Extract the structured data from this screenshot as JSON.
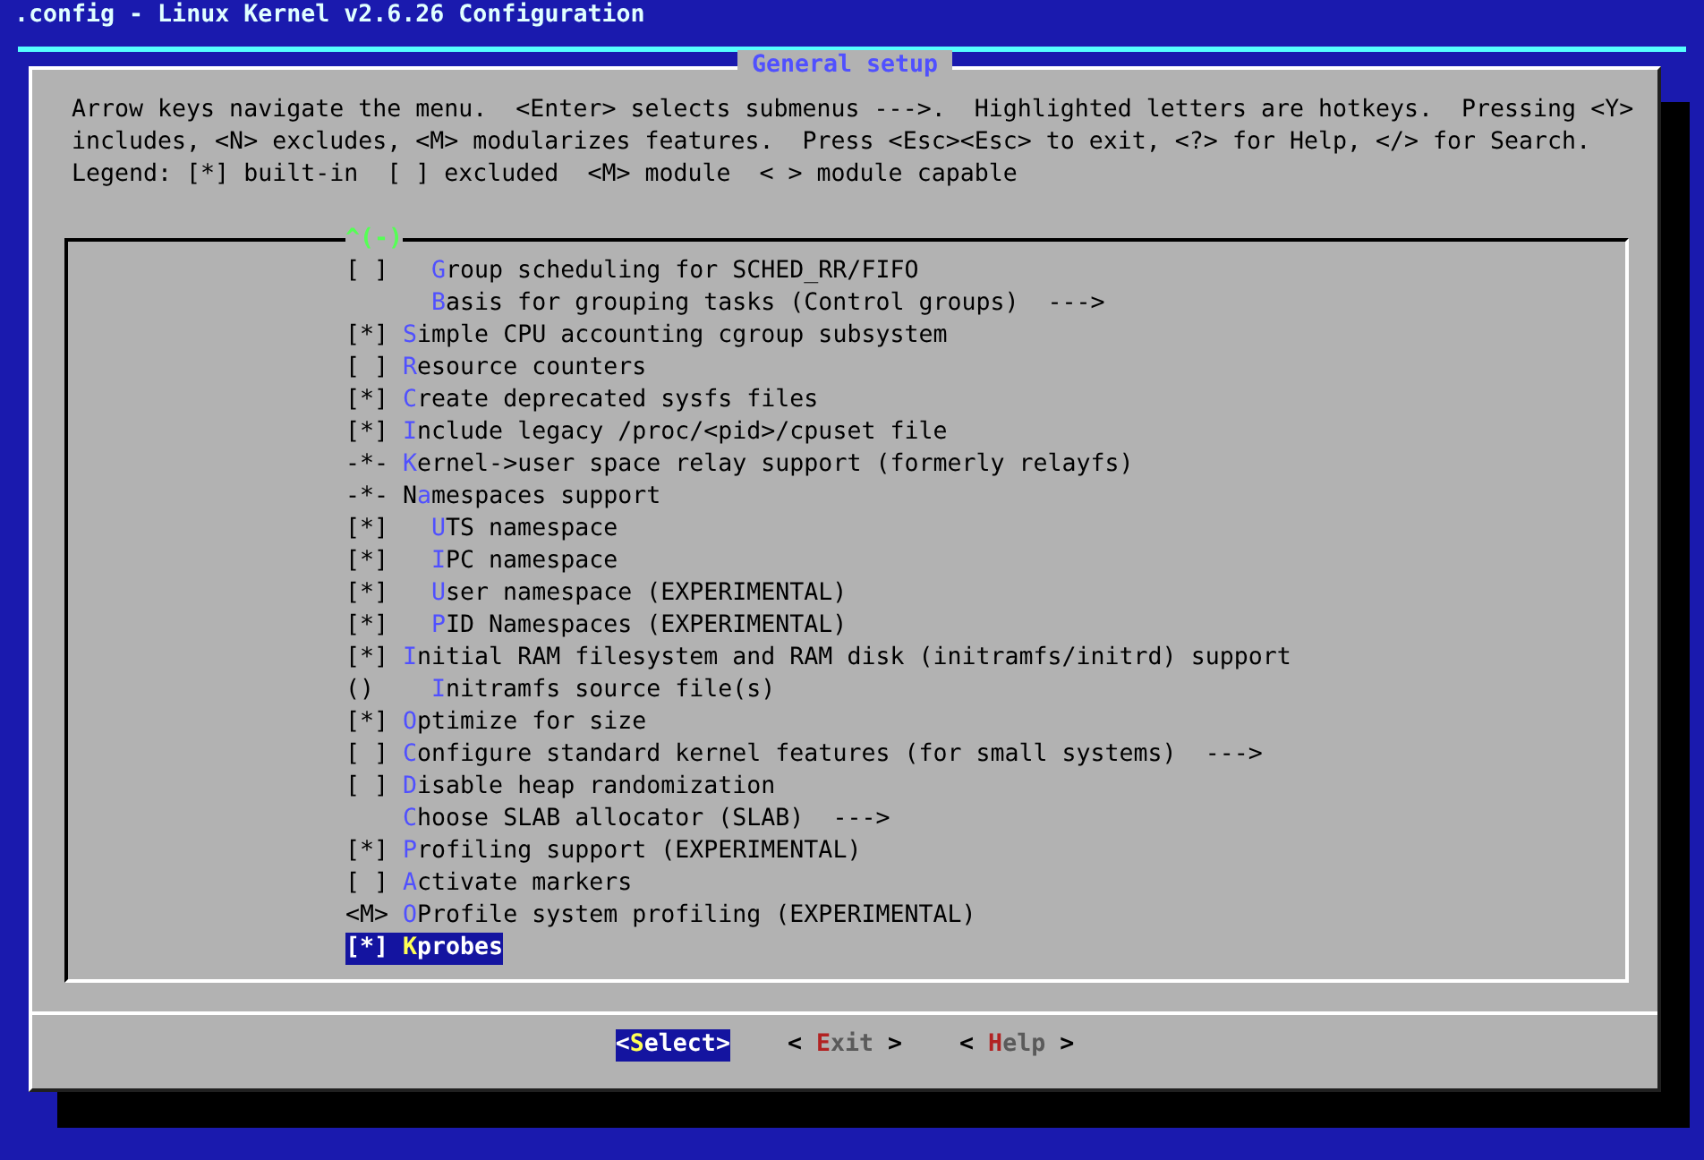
{
  "window": {
    "title": ".config - Linux Kernel v2.6.26 Configuration"
  },
  "dialog": {
    "title": "General setup",
    "help_lines": [
      "Arrow keys navigate the menu.  <Enter> selects submenus --->.  Highlighted letters are hotkeys.  Pressing <Y>",
      "includes, <N> excludes, <M> modularizes features.  Press <Esc><Esc> to exit, <?> for Help, </> for Search.",
      "Legend: [*] built-in  [ ] excluded  <M> module  < > module capable"
    ],
    "scroll_indicator": "^(-)",
    "items": [
      {
        "prefix": "[ ]",
        "indent": true,
        "hotkey": "G",
        "label": "roup scheduling for SCHED_RR/FIFO",
        "selected": false
      },
      {
        "indent": true,
        "hotkey": "B",
        "label": "asis for grouping tasks (Control groups)  --->",
        "selected": false
      },
      {
        "prefix": "[*]",
        "indent": false,
        "hotkey": "S",
        "label": "imple CPU accounting cgroup subsystem",
        "selected": false
      },
      {
        "prefix": "[ ]",
        "indent": false,
        "hotkey": "R",
        "label": "esource counters",
        "selected": false
      },
      {
        "prefix": "[*]",
        "indent": false,
        "hotkey": "C",
        "label": "reate deprecated sysfs files",
        "selected": false
      },
      {
        "prefix": "[*]",
        "indent": false,
        "hotkey": "I",
        "label": "nclude legacy /proc/<pid>/cpuset file",
        "selected": false
      },
      {
        "prefix": "-*-",
        "indent": false,
        "hotkey": "K",
        "label": "ernel->user space relay support (formerly relayfs)",
        "selected": false
      },
      {
        "prefix": "-*-",
        "indent": false,
        "before": "N",
        "hotkey": "a",
        "label": "mespaces support",
        "selected": false
      },
      {
        "prefix": "[*]",
        "indent": true,
        "hotkey": "U",
        "label": "TS namespace",
        "selected": false
      },
      {
        "prefix": "[*]",
        "indent": true,
        "hotkey": "I",
        "label": "PC namespace",
        "selected": false
      },
      {
        "prefix": "[*]",
        "indent": true,
        "hotkey": "U",
        "label": "ser namespace (EXPERIMENTAL)",
        "selected": false
      },
      {
        "prefix": "[*]",
        "indent": true,
        "hotkey": "P",
        "label": "ID Namespaces (EXPERIMENTAL)",
        "selected": false
      },
      {
        "prefix": "[*]",
        "indent": false,
        "hotkey": "I",
        "label": "nitial RAM filesystem and RAM disk (initramfs/initrd) support",
        "selected": false
      },
      {
        "prefix": "()",
        "indent": true,
        "hotkey": "I",
        "label": "nitramfs source file(s)",
        "selected": false
      },
      {
        "prefix": "[*]",
        "indent": false,
        "hotkey": "O",
        "label": "ptimize for size",
        "selected": false
      },
      {
        "prefix": "[ ]",
        "indent": false,
        "hotkey": "C",
        "label": "onfigure standard kernel features (for small systems)  --->",
        "selected": false
      },
      {
        "prefix": "[ ]",
        "indent": false,
        "hotkey": "D",
        "label": "isable heap randomization",
        "selected": false
      },
      {
        "indent": false,
        "hotkey": "C",
        "label": "hoose SLAB allocator (SLAB)  --->",
        "selected": false
      },
      {
        "prefix": "[*]",
        "indent": false,
        "hotkey": "P",
        "label": "rofiling support (EXPERIMENTAL)",
        "selected": false
      },
      {
        "prefix": "[ ]",
        "indent": false,
        "hotkey": "A",
        "label": "ctivate markers",
        "selected": false
      },
      {
        "prefix": "<M>",
        "indent": false,
        "hotkey": "O",
        "label": "Profile system profiling (EXPERIMENTAL)",
        "selected": false
      },
      {
        "prefix": "[*]",
        "indent": false,
        "hotkey": "K",
        "label": "probes",
        "selected": true
      }
    ],
    "buttons": [
      {
        "open": "<",
        "hotkey": "S",
        "label": "elect",
        "close": ">",
        "selected": true
      },
      {
        "open": "< ",
        "hotkey": "E",
        "label": "xit",
        "close": " >",
        "selected": false
      },
      {
        "open": "< ",
        "hotkey": "H",
        "label": "elp",
        "close": " >",
        "selected": false
      }
    ]
  }
}
